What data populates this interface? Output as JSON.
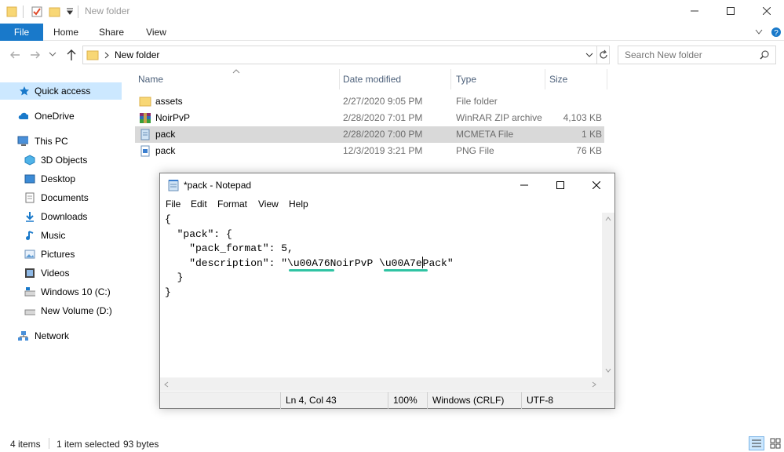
{
  "window": {
    "title": "New folder"
  },
  "ribbon": {
    "tabs": [
      "File",
      "Home",
      "Share",
      "View"
    ]
  },
  "address": {
    "path": "New folder",
    "search_placeholder": "Search New folder"
  },
  "nav": {
    "items": [
      {
        "label": "Quick access",
        "icon": "star-icon"
      },
      {
        "label": "OneDrive",
        "icon": "cloud-icon"
      },
      {
        "label": "This PC",
        "icon": "computer-icon"
      },
      {
        "label": "3D Objects",
        "icon": "cube-icon"
      },
      {
        "label": "Desktop",
        "icon": "desktop-icon"
      },
      {
        "label": "Documents",
        "icon": "documents-icon"
      },
      {
        "label": "Downloads",
        "icon": "download-icon"
      },
      {
        "label": "Music",
        "icon": "music-icon"
      },
      {
        "label": "Pictures",
        "icon": "pictures-icon"
      },
      {
        "label": "Videos",
        "icon": "videos-icon"
      },
      {
        "label": "Windows 10 (C:)",
        "icon": "drive-icon"
      },
      {
        "label": "New Volume (D:)",
        "icon": "drive-icon"
      },
      {
        "label": "Network",
        "icon": "network-icon"
      }
    ]
  },
  "filelist": {
    "columns": [
      "Name",
      "Date modified",
      "Type",
      "Size"
    ],
    "rows": [
      {
        "name": "assets",
        "date": "2/27/2020 9:05 PM",
        "type": "File folder",
        "size": "",
        "icon": "folder-icon"
      },
      {
        "name": "NoirPvP",
        "date": "2/28/2020 7:01 PM",
        "type": "WinRAR ZIP archive",
        "size": "4,103 KB",
        "icon": "winrar-icon"
      },
      {
        "name": "pack",
        "date": "2/28/2020 7:00 PM",
        "type": "MCMETA File",
        "size": "1 KB",
        "icon": "text-file-icon"
      },
      {
        "name": "pack",
        "date": "12/3/2019 3:21 PM",
        "type": "PNG File",
        "size": "76 KB",
        "icon": "image-file-icon"
      }
    ]
  },
  "status": {
    "items": "4 items",
    "selected": "1 item selected",
    "bytes": "93 bytes"
  },
  "notepad": {
    "title": "*pack - Notepad",
    "menu": [
      "File",
      "Edit",
      "Format",
      "View",
      "Help"
    ],
    "lines": [
      "{",
      "  \"pack\": {",
      "    \"pack_format\": 5,",
      "    \"description\": \"\\u00A76NoirPvP \\u00A7e",
      "  }",
      "}"
    ],
    "line4_tail": "Pack\"",
    "status": {
      "position": "Ln 4, Col 43",
      "zoom": "100%",
      "eol": "Windows (CRLF)",
      "encoding": "UTF-8"
    }
  }
}
